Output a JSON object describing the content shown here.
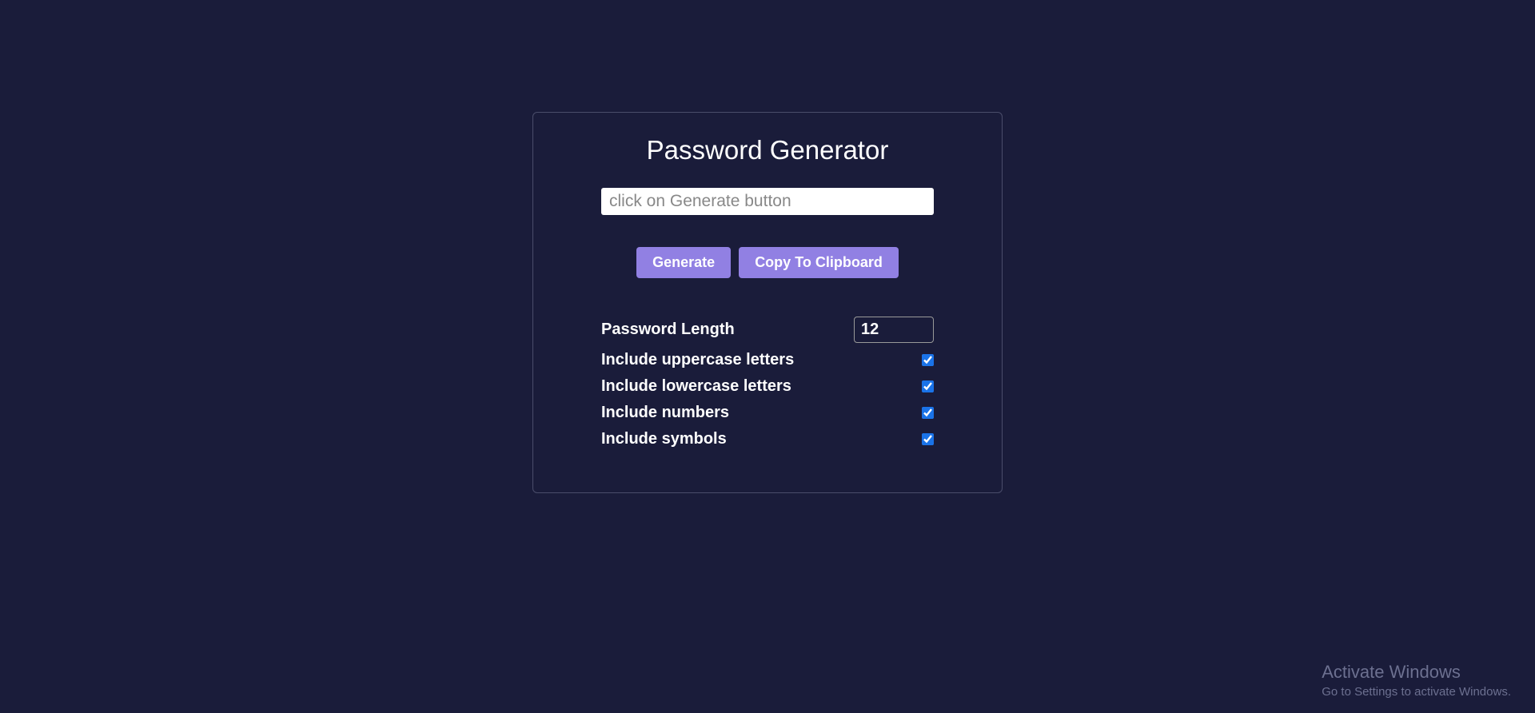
{
  "title": "Password Generator",
  "output": {
    "value": "",
    "placeholder": "click on Generate button"
  },
  "buttons": {
    "generate": "Generate",
    "copy": "Copy To Clipboard"
  },
  "settings": {
    "length": {
      "label": "Password Length",
      "value": "12"
    },
    "uppercase": {
      "label": "Include uppercase letters",
      "checked": true
    },
    "lowercase": {
      "label": "Include lowercase letters",
      "checked": true
    },
    "numbers": {
      "label": "Include numbers",
      "checked": true
    },
    "symbols": {
      "label": "Include symbols",
      "checked": true
    }
  },
  "watermark": {
    "title": "Activate Windows",
    "subtitle": "Go to Settings to activate Windows."
  }
}
